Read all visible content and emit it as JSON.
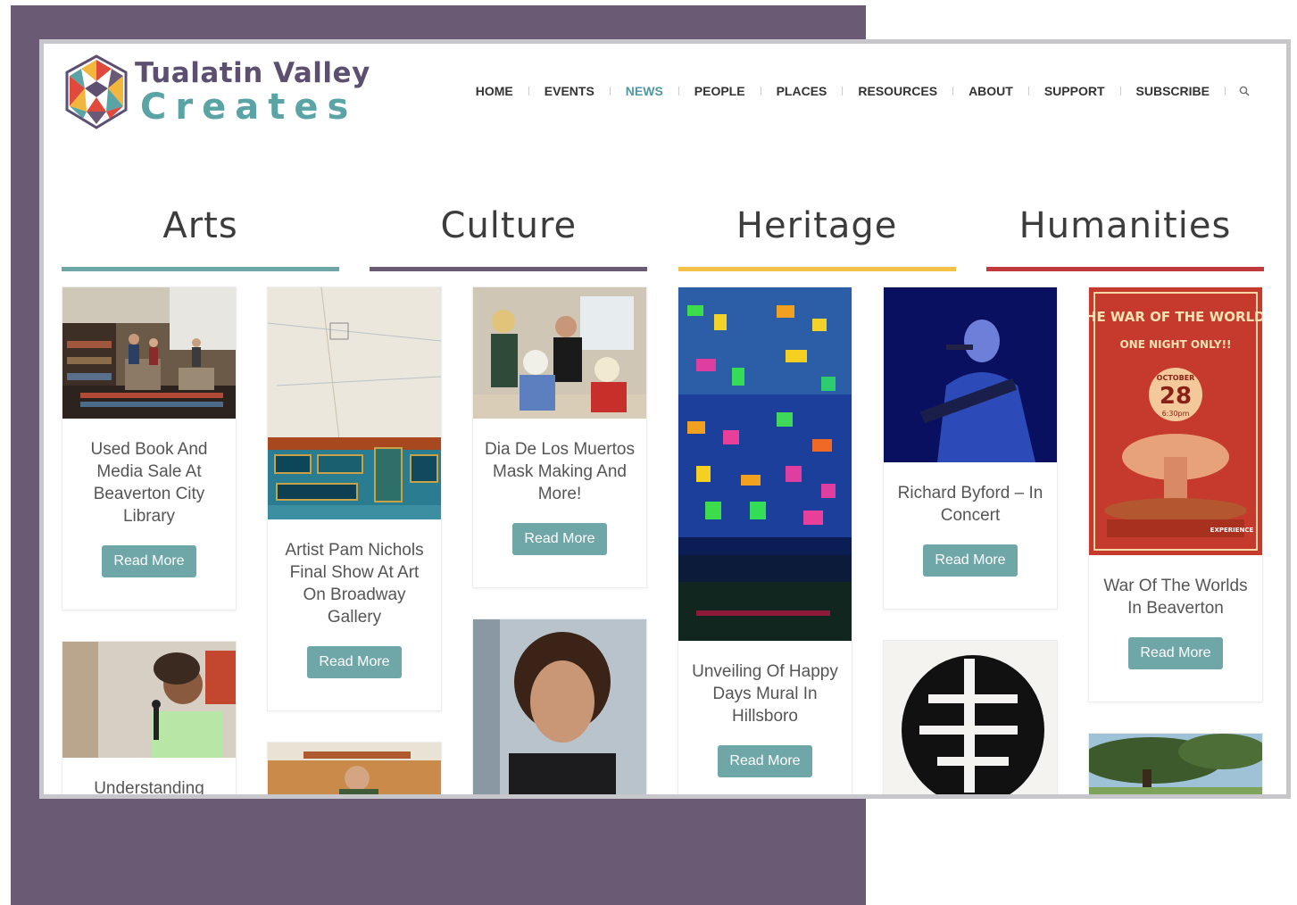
{
  "site": {
    "logo_line1": "Tualatin Valley",
    "logo_line2": "Creates"
  },
  "nav": {
    "items": [
      "HOME",
      "EVENTS",
      "NEWS",
      "PEOPLE",
      "PLACES",
      "RESOURCES",
      "ABOUT",
      "SUPPORT",
      "SUBSCRIBE"
    ],
    "active": "NEWS",
    "search_icon": "magnifier-icon"
  },
  "categories": [
    {
      "label": "Arts",
      "color": "#6fa7a9"
    },
    {
      "label": "Culture",
      "color": "#6b5a74"
    },
    {
      "label": "Heritage",
      "color": "#f3c048"
    },
    {
      "label": "Humanities",
      "color": "#c0393b"
    }
  ],
  "cards": {
    "c1": {
      "title": "Used Book And Media Sale At Beaverton City Library",
      "button": "Read More"
    },
    "c2": {
      "title": "Understanding"
    },
    "c3": {
      "title": "Artist Pam Nichols Final Show At Art On Broadway Gallery",
      "button": "Read More"
    },
    "c4": {
      "title": "Dia De Los Muertos Mask Making And More!",
      "button": "Read More"
    },
    "c5": {
      "title": "Unveiling Of Happy Days Mural In Hillsboro",
      "button": "Read More"
    },
    "c6": {
      "title": "Richard Byford – In Concert",
      "button": "Read More"
    },
    "c7": {
      "title": "War Of The Worlds In Beaverton",
      "button": "Read More"
    }
  },
  "poster": {
    "headline": "THE WAR OF THE WORLDS",
    "tagline": "ONE NIGHT ONLY!!",
    "month": "OCTOBER",
    "day": "28",
    "time": "6:30pm",
    "badge": "EXPERIENCE"
  },
  "colors": {
    "accent": "#4e98a4",
    "button": "#6fa7a9",
    "purple": "#6b5a74"
  }
}
